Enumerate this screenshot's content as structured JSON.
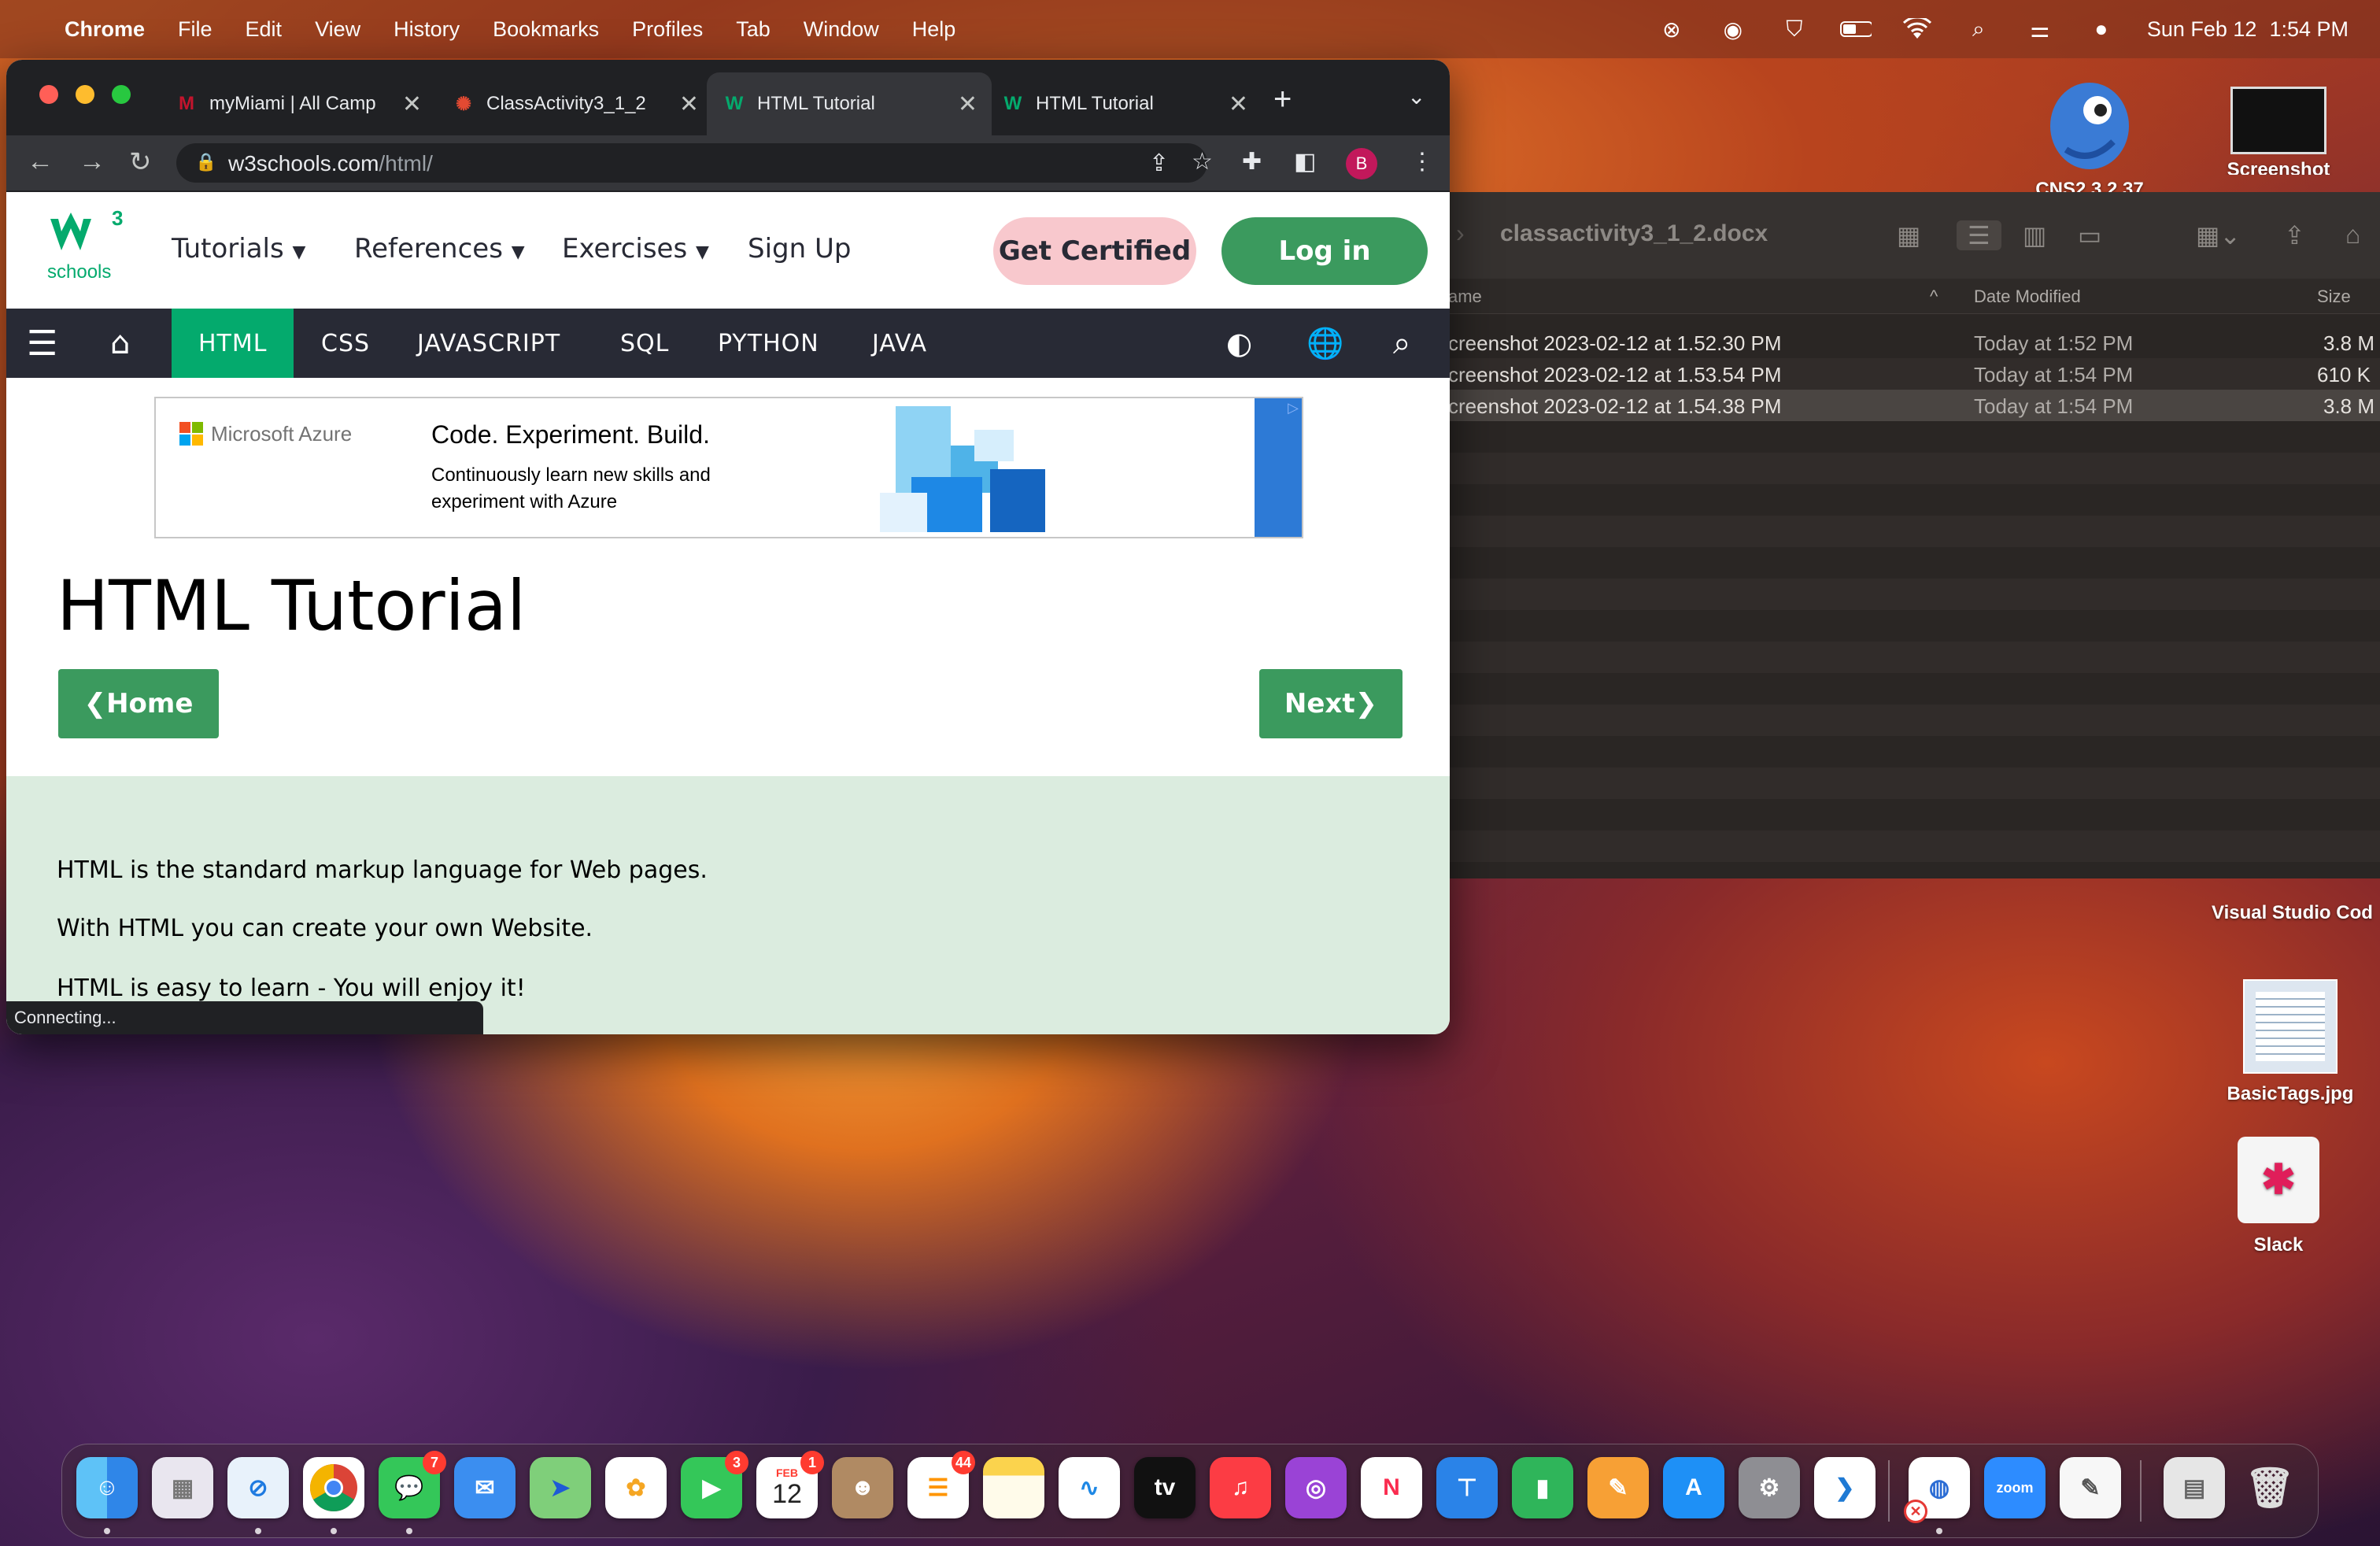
{
  "menubar": {
    "app_name": "Chrome",
    "menus": [
      "File",
      "Edit",
      "View",
      "History",
      "Bookmarks",
      "Profiles",
      "Tab",
      "Window",
      "Help"
    ],
    "date": "Sun Feb 12",
    "time": "1:54 PM"
  },
  "browser": {
    "tabs": [
      {
        "label": "myMiami | All Camp",
        "favicon": "M",
        "active": false
      },
      {
        "label": "ClassActivity3_1_2",
        "favicon": "canvas-icon",
        "active": false
      },
      {
        "label": "HTML Tutorial",
        "favicon": "W",
        "active": true
      },
      {
        "label": "HTML Tutorial",
        "favicon": "W",
        "active": false
      }
    ],
    "url_host": "w3schools.com",
    "url_path": "/html/",
    "profile_initial": "B",
    "status_text": "Connecting..."
  },
  "w3": {
    "logo_text": "schools",
    "logo_sup": "3",
    "nav": [
      "Tutorials",
      "References",
      "Exercises",
      "Sign Up"
    ],
    "get_certified": "Get Certified",
    "login": "Log in",
    "topnav": [
      "HTML",
      "CSS",
      "JAVASCRIPT",
      "SQL",
      "PYTHON",
      "JAVA"
    ],
    "ad": {
      "brand": "Microsoft Azure",
      "headline": "Code. Experiment. Build.",
      "body_line1": "Continuously learn new skills and",
      "body_line2": "experiment with Azure"
    },
    "page_title": "HTML Tutorial",
    "home_button": "Home",
    "next_button": "Next",
    "paragraphs": [
      "HTML is the standard markup language for Web pages.",
      "With HTML you can create your own Website.",
      "HTML is easy to learn - You will enjoy it!"
    ]
  },
  "finder": {
    "title": "classactivity3_1_2.docx",
    "columns": {
      "name": "ame",
      "date": "Date Modified",
      "size": "Size"
    },
    "rows": [
      {
        "name": "creenshot 2023-02-12 at 1.52.30 PM",
        "date": "Today at 1:52 PM",
        "size": "3.8 M"
      },
      {
        "name": "creenshot 2023-02-12 at 1.53.54 PM",
        "date": "Today at 1:54 PM",
        "size": "610 K"
      },
      {
        "name": "creenshot 2023-02-12 at 1.54.38 PM",
        "date": "Today at 1:54 PM",
        "size": "3.8 M"
      }
    ]
  },
  "desktop": {
    "icons": [
      {
        "label": "CNS2 3.2.37"
      },
      {
        "label": "Screenshot"
      },
      {
        "label": "Visual Studio Cod"
      },
      {
        "label": "BasicTags.jpg"
      },
      {
        "label": "Slack"
      }
    ]
  },
  "dock": {
    "badges": {
      "messages": "7",
      "facetime": "3",
      "calendar": "1",
      "reminders": "44"
    },
    "calendar_month": "FEB",
    "calendar_day": "12",
    "tv_label": "tv",
    "zoom_label": "zoom"
  }
}
